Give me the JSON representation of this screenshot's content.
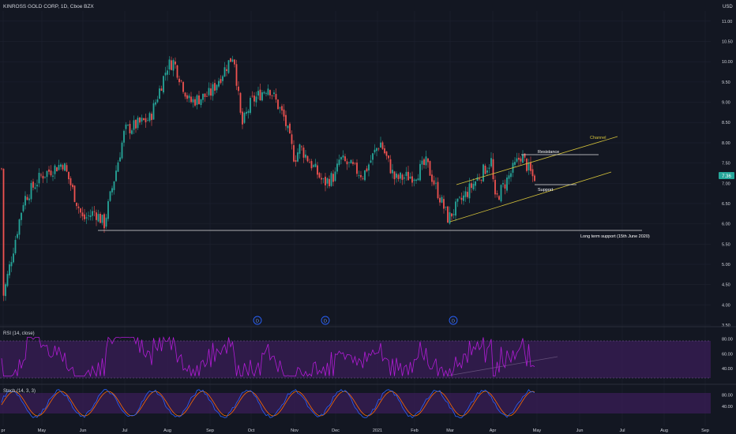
{
  "header": {
    "title": "KINROSS GOLD CORP, 1D, Cboe BZX",
    "currency": "USD"
  },
  "colors": {
    "background": "#131722",
    "up": "#26a69a",
    "down": "#ef5350",
    "grid": "#1e2230",
    "text": "#d1d4dc",
    "channel": "#d4c23a",
    "white_line": "#e0e0e0",
    "rsi_line": "#b21cd6",
    "rsi_band": "#3a1e57",
    "stoch_k": "#2962ff",
    "stoch_d": "#ff6d00",
    "price_tag": "#26a69a"
  },
  "price_axis": {
    "ticks": [
      "11.00",
      "10.50",
      "10.00",
      "9.50",
      "9.00",
      "8.50",
      "8.00",
      "7.50",
      "7.00",
      "6.50",
      "6.00",
      "5.50",
      "5.00",
      "4.50",
      "4.00",
      "3.50"
    ],
    "last_price": "7.36"
  },
  "time_axis": {
    "ticks": [
      "pr",
      "May",
      "Jun",
      "Jul",
      "Aug",
      "Sep",
      "Oct",
      "Nov",
      "Dec",
      "2021",
      "Feb",
      "Mar",
      "Apr",
      "May",
      "Jun",
      "Jul",
      "Aug",
      "Sep"
    ]
  },
  "annotations": {
    "channel": "Channel",
    "resistance": "Resistance",
    "support": "Support",
    "long_term_support": "Long term support (15th June 2020)",
    "event_marker": "D"
  },
  "rsi": {
    "title": "RSI (14, close)",
    "ticks": [
      "80.00",
      "60.00",
      "40.00"
    ]
  },
  "stoch": {
    "title": "Stoch (14, 3, 3)",
    "ticks": [
      "80.00",
      "40.00"
    ]
  },
  "chart_data": {
    "type": "candlestick",
    "title": "KINROSS GOLD CORP, 1D, Cboe BZX",
    "xlabel": "",
    "ylabel": "",
    "ylim": [
      3.5,
      11.25
    ],
    "x_range": [
      "2020-04",
      "2021-09"
    ],
    "anchor_closes": [
      {
        "month": "Apr 2020",
        "value": 4.2
      },
      {
        "month": "May 2020",
        "value": 7.2
      },
      {
        "month": "Jun 2020",
        "value": 6.1
      },
      {
        "month": "Jul 2020",
        "value": 8.3
      },
      {
        "month": "Aug 2020",
        "value": 9.9
      },
      {
        "month": "Sep 2020",
        "value": 9.2
      },
      {
        "month": "Oct 2020",
        "value": 9.0
      },
      {
        "month": "Nov 2020",
        "value": 7.6
      },
      {
        "month": "Dec 2020",
        "value": 7.2
      },
      {
        "month": "Jan 2021",
        "value": 7.9
      },
      {
        "month": "Feb 2021",
        "value": 7.2
      },
      {
        "month": "Mar 2021",
        "value": 6.2
      },
      {
        "month": "Apr 2021",
        "value": 7.6
      },
      {
        "month": "May 2021",
        "value": 7.36
      }
    ],
    "levels": {
      "long_term_support": 5.9,
      "resistance": 7.8,
      "support": 7.0
    },
    "rsi_range": [
      20,
      80
    ],
    "stoch_range": [
      0,
      100
    ]
  }
}
